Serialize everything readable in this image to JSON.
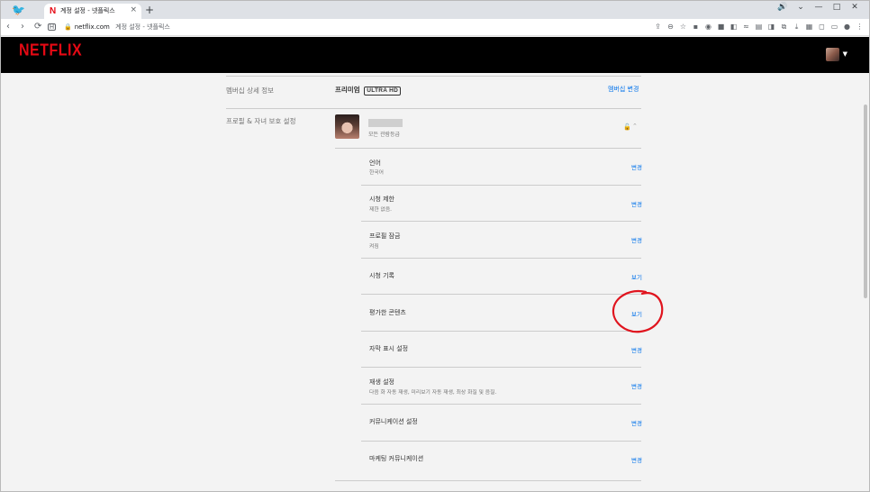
{
  "browser": {
    "tab_title": "계정 설정 - 넷플릭스",
    "url_host": "netflix.com",
    "url_path": "계정 설정 - 넷플릭스"
  },
  "header": {
    "logo": "NETFLIX"
  },
  "membership": {
    "section_title": "멤버십 상세 정보",
    "plan_name": "프리미엄",
    "plan_badge": "ULTRA HD",
    "change_link": "멤버십 변경"
  },
  "profile": {
    "section_title": "프로필 & 자녀 보호 설정",
    "rating": "모든 관람등급"
  },
  "settings": [
    {
      "label": "언어",
      "desc": "한국어",
      "action": "변경"
    },
    {
      "label": "시청 제한",
      "desc": "제한 없음.",
      "action": "변경"
    },
    {
      "label": "프로필 잠금",
      "desc": "켜짐",
      "action": "변경"
    },
    {
      "label": "시청 기록",
      "desc": "",
      "action": "보기"
    },
    {
      "label": "평가한 콘텐츠",
      "desc": "",
      "action": "보기"
    },
    {
      "label": "자막 표시 설정",
      "desc": "",
      "action": "변경"
    },
    {
      "label": "재생 설정",
      "desc": "다음 화 자동 재생, 미리보기 자동 재생, 최상 화질 및 음질.",
      "action": "변경"
    },
    {
      "label": "커뮤니케이션 설정",
      "desc": "",
      "action": "변경"
    },
    {
      "label": "마케팅 커뮤니케이션",
      "desc": "",
      "action": "변경"
    }
  ],
  "colors": {
    "netflix_red": "#e50914",
    "link_blue": "#0071eb",
    "annotation_red": "#e0141e"
  }
}
